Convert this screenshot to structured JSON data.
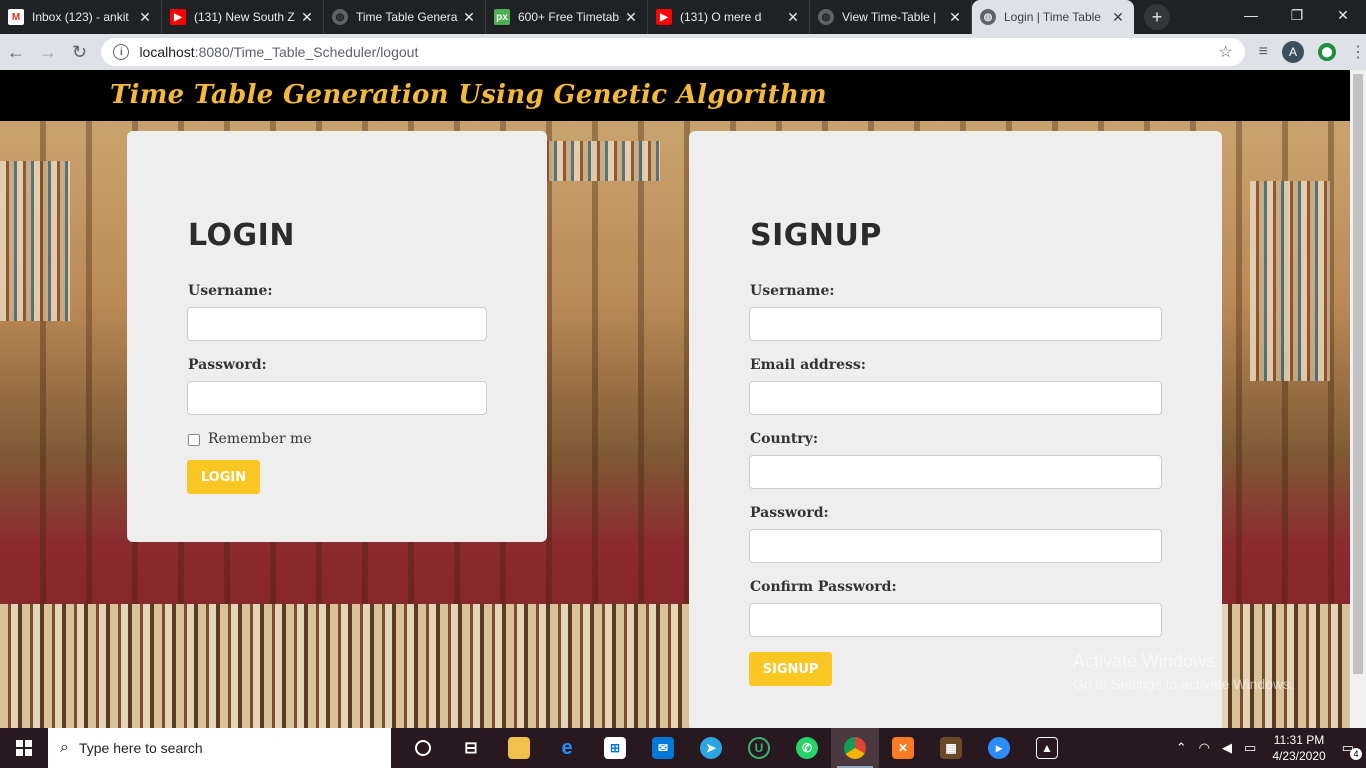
{
  "browser": {
    "tabs": [
      {
        "title": "Inbox (123) - ankit",
        "icon": "gmail-icon",
        "active": false
      },
      {
        "title": "(131) New South Z",
        "icon": "youtube-icon",
        "active": false
      },
      {
        "title": "Time Table Genera",
        "icon": "globe-icon",
        "active": false
      },
      {
        "title": "600+ Free Timetab",
        "icon": "px-icon",
        "active": false
      },
      {
        "title": "(131) O mere d",
        "icon": "youtube-icon",
        "active": false
      },
      {
        "title": "View Time-Table |",
        "icon": "globe-icon",
        "active": false
      },
      {
        "title": "Login | Time Table",
        "icon": "globe-icon",
        "active": true
      }
    ],
    "url_host": "localhost",
    "url_path": ":8080/Time_Table_Scheduler/logout",
    "profile_initial": "A"
  },
  "page": {
    "header_title": "Time Table Generation Using Genetic Algorithm",
    "login": {
      "heading": "LOGIN",
      "username_label": "Username:",
      "password_label": "Password:",
      "remember_label": "Remember me",
      "button_label": "LOGIN"
    },
    "signup": {
      "heading": "SIGNUP",
      "username_label": "Username:",
      "email_label": "Email address:",
      "country_label": "Country:",
      "password_label": "Password:",
      "confirm_label": "Confirm Password:",
      "button_label": "SIGNUP"
    },
    "watermark": {
      "line1": "Activate Windows",
      "line2": "Go to Settings to activate Windows."
    }
  },
  "taskbar": {
    "search_placeholder": "Type here to search",
    "time": "11:31 PM",
    "date": "4/23/2020",
    "notification_count": "4"
  },
  "colors": {
    "accent_button": "#f9c623",
    "header_title": "#f4b93a",
    "header_bg": "#000000",
    "card_bg": "#eeeeee"
  }
}
